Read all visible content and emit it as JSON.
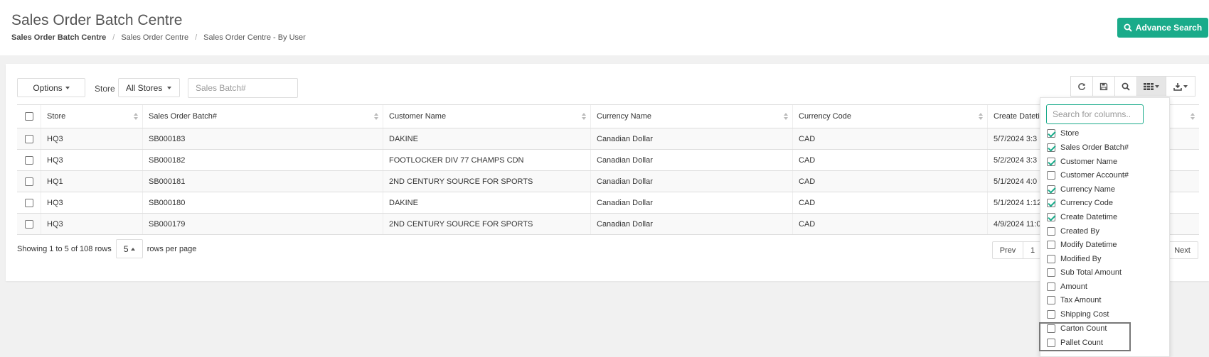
{
  "header": {
    "title": "Sales Order Batch Centre",
    "breadcrumb": [
      "Sales Order Batch Centre",
      "Sales Order Centre",
      "Sales Order Centre - By User"
    ],
    "advance_search_label": "Advance Search"
  },
  "filters": {
    "options_label": "Options",
    "store_label": "Store",
    "store_value": "All Stores",
    "batch_placeholder": "Sales Batch#"
  },
  "table": {
    "columns": [
      "Store",
      "Sales Order Batch#",
      "Customer Name",
      "Currency Name",
      "Currency Code",
      "Create Dateti"
    ],
    "rows": [
      [
        "HQ3",
        "SB000183",
        "DAKINE",
        "Canadian Dollar",
        "CAD",
        "5/7/2024 3:3"
      ],
      [
        "HQ3",
        "SB000182",
        "FOOTLOCKER DIV 77 CHAMPS CDN",
        "Canadian Dollar",
        "CAD",
        "5/2/2024 3:3"
      ],
      [
        "HQ1",
        "SB000181",
        "2ND CENTURY SOURCE FOR SPORTS",
        "Canadian Dollar",
        "CAD",
        "5/1/2024 4:0"
      ],
      [
        "HQ3",
        "SB000180",
        "DAKINE",
        "Canadian Dollar",
        "CAD",
        "5/1/2024 1:12"
      ],
      [
        "HQ3",
        "SB000179",
        "2ND CENTURY SOURCE FOR SPORTS",
        "Canadian Dollar",
        "CAD",
        "4/9/2024 11:0"
      ]
    ]
  },
  "footer": {
    "showing_text": "Showing 1 to 5 of 108 rows",
    "page_size": "5",
    "rows_per_page": "rows per page",
    "prev": "Prev",
    "page": "1",
    "next": "Next"
  },
  "column_menu": {
    "search_placeholder": "Search for columns..",
    "items": [
      {
        "label": "Store",
        "checked": true
      },
      {
        "label": "Sales Order Batch#",
        "checked": true
      },
      {
        "label": "Customer Name",
        "checked": true
      },
      {
        "label": "Customer Account#",
        "checked": false
      },
      {
        "label": "Currency Name",
        "checked": true
      },
      {
        "label": "Currency Code",
        "checked": true
      },
      {
        "label": "Create Datetime",
        "checked": true
      },
      {
        "label": "Created By",
        "checked": false
      },
      {
        "label": "Modify Datetime",
        "checked": false
      },
      {
        "label": "Modified By",
        "checked": false
      },
      {
        "label": "Sub Total Amount",
        "checked": false
      },
      {
        "label": "Amount",
        "checked": false
      },
      {
        "label": "Tax Amount",
        "checked": false
      },
      {
        "label": "Shipping Cost",
        "checked": false
      },
      {
        "label": "Carton Count",
        "checked": false
      },
      {
        "label": "Pallet Count",
        "checked": false
      }
    ]
  },
  "icons": {
    "toolbar": [
      "refresh-icon",
      "save-icon",
      "search-icon",
      "columns-icon",
      "export-icon"
    ]
  },
  "colors": {
    "accent": "#1aab8a",
    "background": "#f1f1f1"
  }
}
